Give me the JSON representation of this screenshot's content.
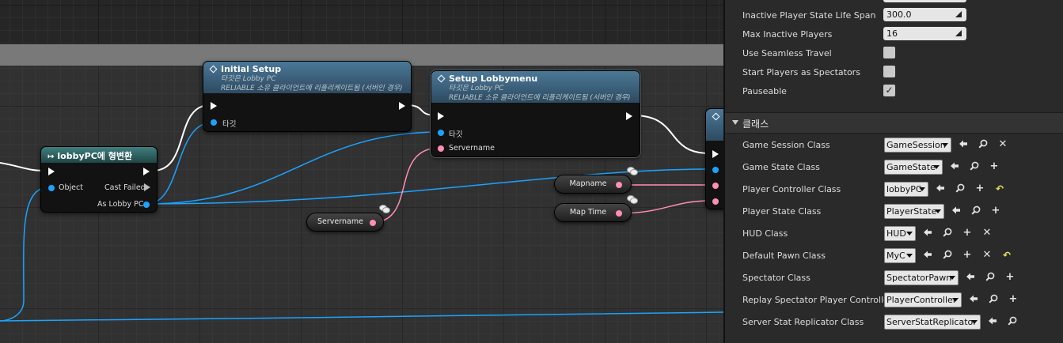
{
  "graph": {
    "nodes": {
      "cast": {
        "title": "lobbyPC에 형변환",
        "pin_object": "Object",
        "pin_cast_failed": "Cast Failed",
        "pin_as": "As Lobby PC"
      },
      "initial_setup": {
        "title": "Initial Setup",
        "sub1": "타깃은 Lobby PC",
        "sub2": "RELIABLE 소유 클라이언트에 리플리케이트됨 (서버인 경우)",
        "pin_target": "타깃"
      },
      "setup_lobbymenu": {
        "title": "Setup Lobbymenu",
        "sub1": "타깃은 Lobby PC",
        "sub2": "RELIABLE 소유 클라이언트에 리플리케이트됨 (서버인 경우)",
        "pin_target": "타깃",
        "pin_servername": "Servername"
      }
    },
    "variables": {
      "servername": "Servername",
      "mapname": "Mapname",
      "map_time": "Map Time"
    },
    "colors": {
      "exec": "#ffffff",
      "object_pin": "#1aa3ff",
      "string_pin": "#ff8fb0",
      "function_header": "#3d6784",
      "cast_header": "#2f6666"
    }
  },
  "details": {
    "rows_top": [
      {
        "label": "Inactive Player State Life Span",
        "value": "300.0"
      },
      {
        "label": "Max Inactive Players",
        "value": "16"
      }
    ],
    "checkbox_rows": [
      {
        "label": "Use Seamless Travel",
        "checked": false,
        "mark": ""
      },
      {
        "label": "Start Players as Spectators",
        "checked": false,
        "mark": ""
      },
      {
        "label": "Pauseable",
        "checked": true,
        "mark": "✓"
      }
    ],
    "category": "클래스",
    "class_rows": [
      {
        "label": "Game Session Class",
        "value": "GameSession",
        "actions": [
          "arrow-left-icon",
          "search-icon",
          "clear-icon"
        ]
      },
      {
        "label": "Game State Class",
        "value": "GameState",
        "actions": [
          "arrow-left-icon",
          "search-icon",
          "add-icon"
        ]
      },
      {
        "label": "Player Controller Class",
        "value": "lobbyPC",
        "actions": [
          "arrow-left-icon",
          "search-icon",
          "add-icon",
          "reset-icon"
        ]
      },
      {
        "label": "Player State Class",
        "value": "PlayerState",
        "actions": [
          "arrow-left-icon",
          "search-icon",
          "add-icon"
        ]
      },
      {
        "label": "HUD Class",
        "value": "HUD",
        "actions": [
          "arrow-left-icon",
          "search-icon",
          "add-icon",
          "clear-icon"
        ]
      },
      {
        "label": "Default Pawn Class",
        "value": "MyC",
        "actions": [
          "arrow-left-icon",
          "search-icon",
          "add-icon",
          "clear-icon",
          "reset-icon"
        ]
      },
      {
        "label": "Spectator Class",
        "value": "SpectatorPawn",
        "actions": [
          "arrow-left-icon",
          "search-icon",
          "add-icon"
        ]
      },
      {
        "label": "Replay Spectator Player Controller",
        "value": "PlayerController",
        "actions": [
          "arrow-left-icon",
          "search-icon",
          "add-icon"
        ]
      },
      {
        "label": "Server Stat Replicator Class",
        "value": "ServerStatReplicator",
        "actions": [
          "arrow-left-icon",
          "search-icon"
        ]
      }
    ]
  }
}
